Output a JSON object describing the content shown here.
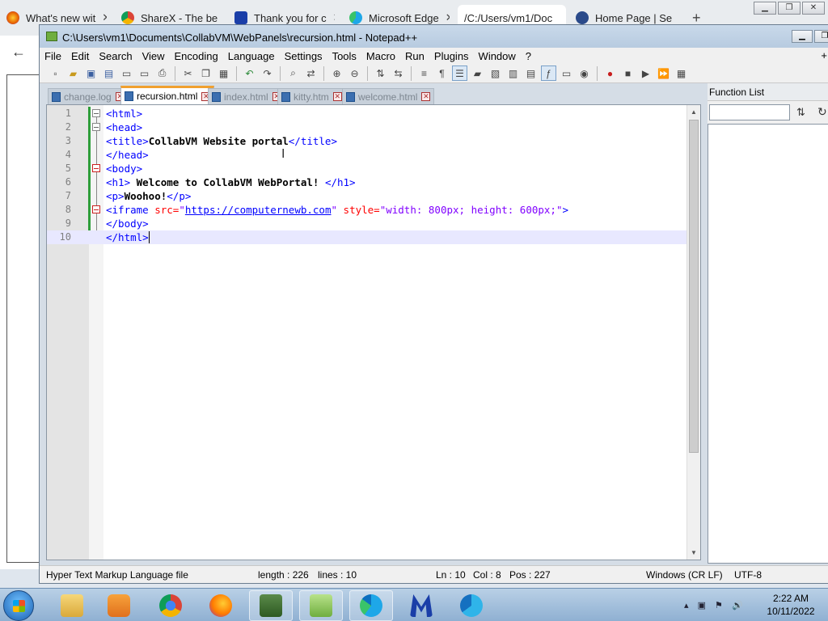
{
  "browser": {
    "tabs": [
      {
        "title": "What's new wit",
        "icon": "firefox-icon"
      },
      {
        "title": "ShareX - The be",
        "icon": "chrome-icon"
      },
      {
        "title": "Thank you for c",
        "icon": "malwarebytes-icon"
      },
      {
        "title": "Microsoft Edge",
        "icon": "edge-icon"
      },
      {
        "title": "/C:/Users/vm1/Doc",
        "icon": "file-icon"
      },
      {
        "title": "Home Page | Se",
        "icon": "site-icon"
      }
    ],
    "new_tab": "+"
  },
  "notepad": {
    "title": "C:\\Users\\vm1\\Documents\\CollabVM\\WebPanels\\recursion.html - Notepad++",
    "menu": [
      "File",
      "Edit",
      "Search",
      "View",
      "Encoding",
      "Language",
      "Settings",
      "Tools",
      "Macro",
      "Run",
      "Plugins",
      "Window",
      "?"
    ],
    "menu_plus": "+",
    "file_tabs": [
      {
        "label": "change.log",
        "active": false
      },
      {
        "label": "recursion.html",
        "active": true
      },
      {
        "label": "index.html",
        "active": false
      },
      {
        "label": "kitty.htm",
        "active": false
      },
      {
        "label": "welcome.html",
        "active": false
      }
    ],
    "line_numbers": [
      "1",
      "2",
      "3",
      "4",
      "5",
      "6",
      "7",
      "8",
      "9",
      "10"
    ],
    "code": {
      "l1": "<html>",
      "l2": "<head>",
      "l3_open": "<title>",
      "l3_text": "CollabVM Website portal",
      "l3_close": "</title>",
      "l4": "</head>",
      "l5": "<body>",
      "l6_open": "<h1>",
      "l6_text": " Welcome to CollabVM WebPortal! ",
      "l6_close": "</h1>",
      "l7_open": "<p>",
      "l7_text": "Woohoo!",
      "l7_close": "</p>",
      "l8_tag": "<iframe",
      "l8_attr1": " src=",
      "l8_q1": "\"",
      "l8_url": "https://computernewb.com",
      "l8_q2": "\"",
      "l8_attr2": " style=",
      "l8_style": "\"width: 800px; height: 600px;\"",
      "l8_end": ">",
      "l9": "</body>",
      "l10": "</html>"
    },
    "function_list": {
      "title": "Function List",
      "sort_icon": "sort-az-icon",
      "refresh_icon": "refresh-icon"
    },
    "status": {
      "file_type": "Hyper Text Markup Language file",
      "length": "length : 226",
      "lines": "lines : 10",
      "ln": "Ln : 10",
      "col": "Col : 8",
      "pos": "Pos : 227",
      "eol": "Windows (CR LF)",
      "encoding": "UTF-8"
    }
  },
  "taskbar": {
    "time": "2:22 AM",
    "date": "10/11/2022"
  },
  "colors": {
    "tag": "#0000ff",
    "attribute": "#ff0000",
    "string": "#8000ff",
    "active_tab_accent": "#f0a030",
    "current_line": "#e8e8ff"
  }
}
